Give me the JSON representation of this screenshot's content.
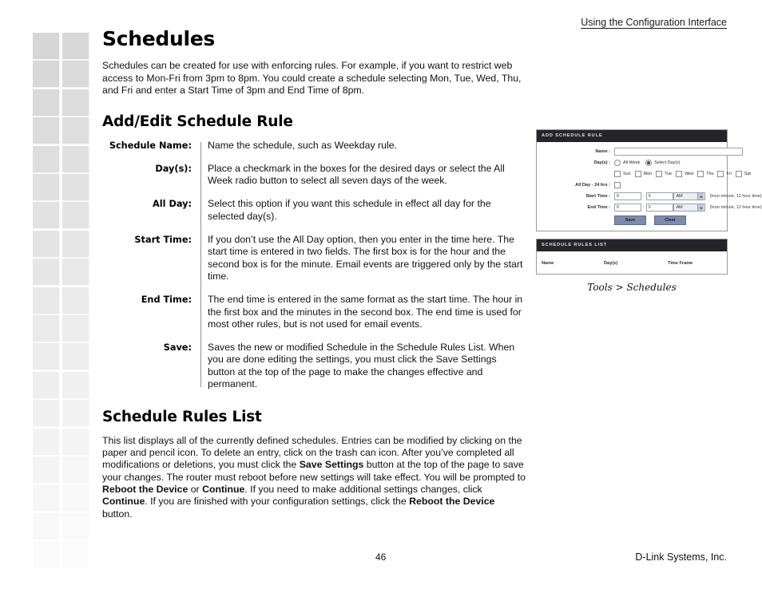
{
  "header": {
    "running_head": "Using the Configuration Interface"
  },
  "footer": {
    "page_number": "46",
    "brand": "D-Link Systems, Inc."
  },
  "main": {
    "title": "Schedules",
    "intro": "Schedules can be created for use with enforcing rules. For example, if you want to restrict web access to Mon-Fri from 3pm to 8pm. You could create a schedule selecting Mon, Tue, Wed, Thu, and Fri and enter a Start Time of 3pm and End Time of 8pm.",
    "subtitle": "Add/Edit Schedule Rule",
    "definitions": [
      {
        "label": "Schedule Name:",
        "desc": "Name the schedule, such as Weekday rule."
      },
      {
        "label": "Day(s):",
        "desc": "Place a checkmark in the boxes for the desired days or select the All Week radio button to select all seven days of the week."
      },
      {
        "label": "All Day:",
        "desc": "Select this option if you want this schedule in effect all day for the selected day(s)."
      },
      {
        "label": "Start Time:",
        "desc": "If you don’t use the All Day option, then you enter in the time here. The start time is entered in two fields. The first box is for the hour and the second box is for the minute. Email events are triggered only by the start time."
      },
      {
        "label": "End Time:",
        "desc": "The end time is entered in the same format as the start time. The hour in the first box and the minutes in the second box. The end time is used for most other rules, but is not used for email events."
      },
      {
        "label": "Save:",
        "desc": "Saves the new or modified Schedule in the Schedule Rules List. When you are done editing the settings, you must click the Save Settings button at the top of the page to make the changes effective and permanent."
      }
    ],
    "rules_list_title": "Schedule Rules List",
    "rules_list_body_part1": "This list displays all of the currently defined schedules. Entries can be modified by clicking on the paper and pencil icon. To delete an entry, click on the trash can icon. After you’ve completed all modifications or deletions, you must click the ",
    "rules_list_bold1": "Save Settings",
    "rules_list_body_part2": " button at the top of the page to save your changes. The router must reboot before new settings will take effect. You will be prompted to ",
    "rules_list_bold2": "Reboot the Device",
    "rules_list_body_part3": " or ",
    "rules_list_bold3": "Continue",
    "rules_list_body_part4": ". If you need to make additional settings changes, click ",
    "rules_list_bold4": "Continue",
    "rules_list_body_part5": ". If you are finished with your configuration settings, click the ",
    "rules_list_bold5": "Reboot the Device",
    "rules_list_body_part6": " button."
  },
  "ui_mock": {
    "add_panel": {
      "header": "ADD SCHEDULE RULE",
      "name_label": "Name :",
      "name_value": "",
      "days_label": "Day(s) :",
      "radio_all_week": "All Week",
      "radio_select_days": "Select Day(s)",
      "radio_selected": "Select Day(s)",
      "days": [
        "Sun",
        "Mon",
        "Tue",
        "Wed",
        "Thu",
        "Fri",
        "Sat"
      ],
      "all_day_label": "All Day - 24 hrs :",
      "start_time_label": "Start Time :",
      "end_time_label": "End Time :",
      "start_hour": "0",
      "start_minute": "0",
      "start_meridiem": "AM",
      "end_hour": "0",
      "end_minute": "0",
      "end_meridiem": "AM",
      "time_hint": "(hour:minute, 12 hour time)",
      "save_button": "Save",
      "clear_button": "Clear"
    },
    "list_panel": {
      "header": "SCHEDULE RULES LIST",
      "columns": [
        "Name",
        "Day(s)",
        "Time Frame"
      ]
    },
    "caption": "Tools > Schedules"
  },
  "decoration": {
    "square_color": "#d6d6d6",
    "rows": 19,
    "cols": 2
  }
}
